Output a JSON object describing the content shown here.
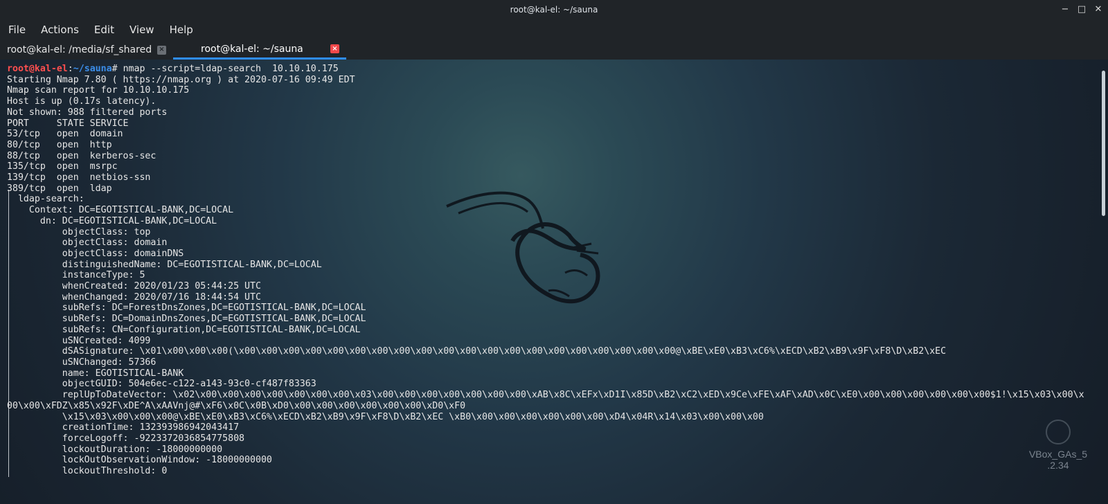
{
  "window": {
    "title": "root@kal-el: ~/sauna",
    "controls": [
      "minimize-icon",
      "maximize-icon",
      "close-icon"
    ]
  },
  "menu": {
    "items": [
      "File",
      "Actions",
      "Edit",
      "View",
      "Help"
    ]
  },
  "tabs": [
    {
      "label": "root@kal-el: /media/sf_shared",
      "active": false
    },
    {
      "label": "root@kal-el: ~/sauna",
      "active": true
    }
  ],
  "terminal": {
    "prompt": {
      "user": "root",
      "at": "@",
      "host": "kal-el",
      "colon": ":",
      "path": "~/sauna",
      "hash": "#",
      "command": " nmap --script=ldap-search  10.10.10.175"
    },
    "lines": [
      "Starting Nmap 7.80 ( https://nmap.org ) at 2020-07-16 09:49 EDT",
      "Nmap scan report for 10.10.10.175",
      "Host is up (0.17s latency).",
      "Not shown: 988 filtered ports",
      "PORT     STATE SERVICE",
      "53/tcp   open  domain",
      "80/tcp   open  http",
      "88/tcp   open  kerberos-sec",
      "135/tcp  open  msrpc",
      "139/tcp  open  netbios-ssn",
      "389/tcp  open  ldap",
      "  ldap-search:",
      "    Context: DC=EGOTISTICAL-BANK,DC=LOCAL",
      "      dn: DC=EGOTISTICAL-BANK,DC=LOCAL",
      "          objectClass: top",
      "          objectClass: domain",
      "          objectClass: domainDNS",
      "          distinguishedName: DC=EGOTISTICAL-BANK,DC=LOCAL",
      "          instanceType: 5",
      "          whenCreated: 2020/01/23 05:44:25 UTC",
      "          whenChanged: 2020/07/16 18:44:54 UTC",
      "          subRefs: DC=ForestDnsZones,DC=EGOTISTICAL-BANK,DC=LOCAL",
      "          subRefs: DC=DomainDnsZones,DC=EGOTISTICAL-BANK,DC=LOCAL",
      "          subRefs: CN=Configuration,DC=EGOTISTICAL-BANK,DC=LOCAL",
      "          uSNCreated: 4099",
      "          dSASignature: \\x01\\x00\\x00\\x00(\\x00\\x00\\x00\\x00\\x00\\x00\\x00\\x00\\x00\\x00\\x00\\x00\\x00\\x00\\x00\\x00\\x00\\x00\\x00\\x00@\\xBE\\xE0\\xB3\\xC6%\\xECD\\xB2\\xB9\\x9F\\xF8\\D\\xB2\\xEC",
      "          uSNChanged: 57366",
      "          name: EGOTISTICAL-BANK",
      "          objectGUID: 504e6ec-c122-a143-93c0-cf487f83363",
      "          replUpToDateVector: \\x02\\x00\\x00\\x00\\x00\\x00\\x00\\x00\\x03\\x00\\x00\\x00\\x00\\x00\\x00\\x00\\xAB\\x8C\\xEFx\\xD1I\\x85D\\xB2\\xC2\\xED\\x9Ce\\xFE\\xAF\\xAD\\x0C\\xE0\\x00\\x00\\x00\\x00\\x00\\x00$1!\\x15\\x03\\x00\\x",
      "00\\x00\\xFDZ\\x85\\x92F\\xDE^A\\xAAVnj@#\\xF6\\x0C\\x0B\\xD0\\x00\\x00\\x00\\x00\\x00\\x00\\xD0\\xF0",
      "          \\x15\\x03\\x00\\x00\\x00@\\xBE\\xE0\\xB3\\xC6%\\xECD\\xB2\\xB9\\x9F\\xF8\\D\\xB2\\xEC \\xB0\\x00\\x00\\x00\\x00\\x00\\x00\\xD4\\x04R\\x14\\x03\\x00\\x00\\x00",
      "          creationTime: 132393986942043417",
      "          forceLogoff: -9223372036854775808",
      "          lockoutDuration: -18000000000",
      "          lockOutObservationWindow: -18000000000",
      "          lockoutThreshold: 0"
    ]
  },
  "overlay": {
    "vbox_label": "VBox_GAs_5\n.2.34"
  }
}
